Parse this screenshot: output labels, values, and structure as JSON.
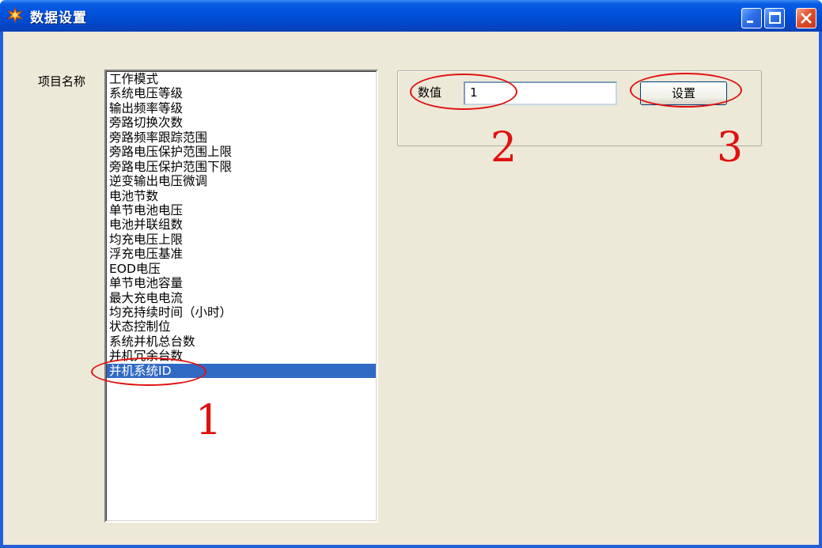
{
  "window": {
    "title": "数据设置",
    "colors": {
      "titlebar": "#0052dd",
      "client": "#ece9d8",
      "selection": "#316ac5",
      "annotation": "#e01010"
    },
    "buttons": [
      "minimize-icon",
      "maximize-icon",
      "close-icon"
    ]
  },
  "list": {
    "label": "项目名称",
    "items": [
      "工作模式",
      "系统电压等级",
      "输出频率等级",
      "旁路切换次数",
      "旁路频率跟踪范围",
      "旁路电压保护范围上限",
      "旁路电压保护范围下限",
      "逆变输出电压微调",
      "电池节数",
      "单节电池电压",
      "电池并联组数",
      "均充电压上限",
      "浮充电压基准",
      "EOD电压",
      "单节电池容量",
      "最大充电电流",
      "均充持续时间（小时）",
      "状态控制位",
      "系统并机总台数",
      "并机冗余台数",
      "并机系统ID"
    ],
    "selected": "并机系统ID"
  },
  "value_group": {
    "label": "数值",
    "input_value": "1",
    "set_button": "设置"
  },
  "annotations": {
    "step1": "1",
    "step2": "2",
    "step3": "3"
  }
}
